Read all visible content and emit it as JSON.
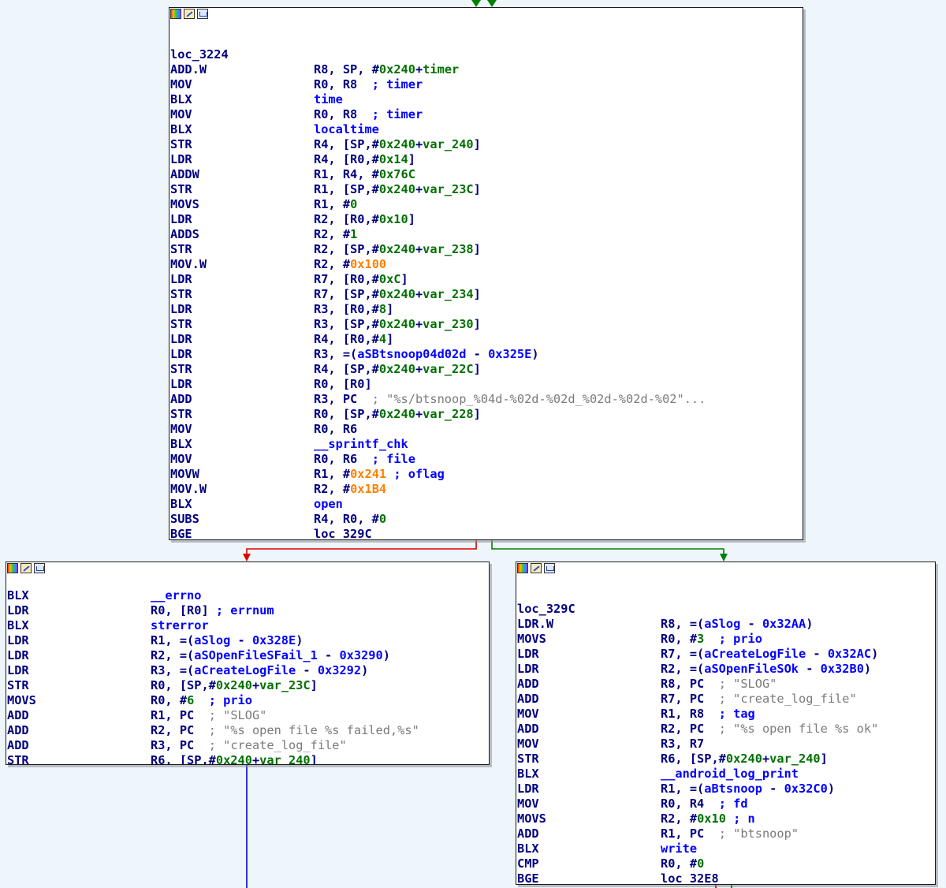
{
  "colors": {
    "background": "#eef6fb",
    "register": "#000080",
    "symbol": "#0000ff",
    "variable": "#007000",
    "immediate_hex": "#ff7f00",
    "string_comment": "#7a7a7a",
    "edge_true": "#008000",
    "edge_false": "#e00000",
    "edge_uncond": "#0000cc"
  },
  "titlebar_icons": [
    "color-palette-icon",
    "edit-pencil-icon",
    "graph-overview-icon"
  ],
  "blocks": [
    {
      "id": "top",
      "label": "loc_3224",
      "lines": [
        {
          "m": "ADD.W",
          "o": [
            [
              "reg",
              "R8, SP, "
            ],
            [
              "punct",
              "#"
            ],
            [
              "num",
              "0x240"
            ],
            [
              "punct",
              "+"
            ],
            [
              "var",
              "timer"
            ]
          ]
        },
        {
          "m": "MOV",
          "o": [
            [
              "reg",
              "R0, R8  "
            ],
            [
              "cmt",
              "; timer"
            ]
          ]
        },
        {
          "m": "BLX",
          "o": [
            [
              "sym",
              "time"
            ]
          ]
        },
        {
          "m": "MOV",
          "o": [
            [
              "reg",
              "R0, R8  "
            ],
            [
              "cmt",
              "; timer"
            ]
          ]
        },
        {
          "m": "BLX",
          "o": [
            [
              "sym",
              "localtime"
            ]
          ]
        },
        {
          "m": "STR",
          "o": [
            [
              "reg",
              "R4, [SP,#"
            ],
            [
              "num",
              "0x240"
            ],
            [
              "punct",
              "+"
            ],
            [
              "var",
              "var_240"
            ],
            [
              "punct",
              "]"
            ]
          ]
        },
        {
          "m": "LDR",
          "o": [
            [
              "reg",
              "R4, [R0,#"
            ],
            [
              "num",
              "0x14"
            ],
            [
              "punct",
              "]"
            ]
          ]
        },
        {
          "m": "ADDW",
          "o": [
            [
              "reg",
              "R1, R4, #"
            ],
            [
              "num",
              "0x76C"
            ]
          ]
        },
        {
          "m": "STR",
          "o": [
            [
              "reg",
              "R1, [SP,#"
            ],
            [
              "num",
              "0x240"
            ],
            [
              "punct",
              "+"
            ],
            [
              "var",
              "var_23C"
            ],
            [
              "punct",
              "]"
            ]
          ]
        },
        {
          "m": "MOVS",
          "o": [
            [
              "reg",
              "R1, #"
            ],
            [
              "num",
              "0"
            ]
          ]
        },
        {
          "m": "LDR",
          "o": [
            [
              "reg",
              "R2, [R0,#"
            ],
            [
              "num",
              "0x10"
            ],
            [
              "punct",
              "]"
            ]
          ]
        },
        {
          "m": "ADDS",
          "o": [
            [
              "reg",
              "R2, #"
            ],
            [
              "num",
              "1"
            ]
          ]
        },
        {
          "m": "STR",
          "o": [
            [
              "reg",
              "R2, [SP,#"
            ],
            [
              "num",
              "0x240"
            ],
            [
              "punct",
              "+"
            ],
            [
              "var",
              "var_238"
            ],
            [
              "punct",
              "]"
            ]
          ]
        },
        {
          "m": "MOV.W",
          "o": [
            [
              "reg",
              "R2, #"
            ],
            [
              "imm",
              "0x100"
            ]
          ]
        },
        {
          "m": "LDR",
          "o": [
            [
              "reg",
              "R7, [R0,#"
            ],
            [
              "num",
              "0xC"
            ],
            [
              "punct",
              "]"
            ]
          ]
        },
        {
          "m": "STR",
          "o": [
            [
              "reg",
              "R7, [SP,#"
            ],
            [
              "num",
              "0x240"
            ],
            [
              "punct",
              "+"
            ],
            [
              "var",
              "var_234"
            ],
            [
              "punct",
              "]"
            ]
          ]
        },
        {
          "m": "LDR",
          "o": [
            [
              "reg",
              "R3, [R0,#"
            ],
            [
              "num",
              "8"
            ],
            [
              "punct",
              "]"
            ]
          ]
        },
        {
          "m": "STR",
          "o": [
            [
              "reg",
              "R3, [SP,#"
            ],
            [
              "num",
              "0x240"
            ],
            [
              "punct",
              "+"
            ],
            [
              "var",
              "var_230"
            ],
            [
              "punct",
              "]"
            ]
          ]
        },
        {
          "m": "LDR",
          "o": [
            [
              "reg",
              "R4, [R0,#"
            ],
            [
              "num",
              "4"
            ],
            [
              "punct",
              "]"
            ]
          ]
        },
        {
          "m": "LDR",
          "o": [
            [
              "reg",
              "R3, =("
            ],
            [
              "sym",
              "aSBtsnoop04d02d"
            ],
            [
              "reg",
              " - "
            ],
            [
              "sym",
              "0x325E"
            ],
            [
              "reg",
              ")"
            ]
          ]
        },
        {
          "m": "STR",
          "o": [
            [
              "reg",
              "R4, [SP,#"
            ],
            [
              "num",
              "0x240"
            ],
            [
              "punct",
              "+"
            ],
            [
              "var",
              "var_22C"
            ],
            [
              "punct",
              "]"
            ]
          ]
        },
        {
          "m": "LDR",
          "o": [
            [
              "reg",
              "R0, [R0]"
            ]
          ]
        },
        {
          "m": "ADD",
          "o": [
            [
              "reg",
              "R3, PC  "
            ],
            [
              "str",
              "; \"%s/btsnoop_%04d-%02d-%02d_%02d-%02d-%02\"..."
            ]
          ]
        },
        {
          "m": "STR",
          "o": [
            [
              "reg",
              "R0, [SP,#"
            ],
            [
              "num",
              "0x240"
            ],
            [
              "punct",
              "+"
            ],
            [
              "var",
              "var_228"
            ],
            [
              "punct",
              "]"
            ]
          ]
        },
        {
          "m": "MOV",
          "o": [
            [
              "reg",
              "R0, R6"
            ]
          ]
        },
        {
          "m": "BLX",
          "o": [
            [
              "sym",
              "__sprintf_chk"
            ]
          ]
        },
        {
          "m": "MOV",
          "o": [
            [
              "reg",
              "R0, R6  "
            ],
            [
              "cmt",
              "; file"
            ]
          ]
        },
        {
          "m": "MOVW",
          "o": [
            [
              "reg",
              "R1, #"
            ],
            [
              "imm",
              "0x241"
            ],
            [
              "cmt",
              " ; oflag"
            ]
          ]
        },
        {
          "m": "MOV.W",
          "o": [
            [
              "reg",
              "R2, #"
            ],
            [
              "imm",
              "0x1B4"
            ]
          ]
        },
        {
          "m": "BLX",
          "o": [
            [
              "sym",
              "open"
            ]
          ]
        },
        {
          "m": "SUBS",
          "o": [
            [
              "reg",
              "R4, R0, #"
            ],
            [
              "num",
              "0"
            ]
          ]
        },
        {
          "m": "BGE",
          "o": [
            [
              "reg",
              "loc_329C"
            ]
          ]
        }
      ]
    },
    {
      "id": "left",
      "label": "",
      "lines": [
        {
          "m": "BLX",
          "o": [
            [
              "sym",
              "__errno"
            ]
          ]
        },
        {
          "m": "LDR",
          "o": [
            [
              "reg",
              "R0, [R0] "
            ],
            [
              "cmt",
              "; errnum"
            ]
          ]
        },
        {
          "m": "BLX",
          "o": [
            [
              "sym",
              "strerror"
            ]
          ]
        },
        {
          "m": "LDR",
          "o": [
            [
              "reg",
              "R1, =("
            ],
            [
              "sym",
              "aSlog"
            ],
            [
              "reg",
              " - "
            ],
            [
              "sym",
              "0x328E"
            ],
            [
              "reg",
              ")"
            ]
          ]
        },
        {
          "m": "LDR",
          "o": [
            [
              "reg",
              "R2, =("
            ],
            [
              "sym",
              "aSOpenFileSFail_1"
            ],
            [
              "reg",
              " - "
            ],
            [
              "sym",
              "0x3290"
            ],
            [
              "reg",
              ")"
            ]
          ]
        },
        {
          "m": "LDR",
          "o": [
            [
              "reg",
              "R3, =("
            ],
            [
              "sym",
              "aCreateLogFile"
            ],
            [
              "reg",
              " - "
            ],
            [
              "sym",
              "0x3292"
            ],
            [
              "reg",
              ")"
            ]
          ]
        },
        {
          "m": "STR",
          "o": [
            [
              "reg",
              "R0, [SP,#"
            ],
            [
              "num",
              "0x240"
            ],
            [
              "punct",
              "+"
            ],
            [
              "var",
              "var_23C"
            ],
            [
              "punct",
              "]"
            ]
          ]
        },
        {
          "m": "MOVS",
          "o": [
            [
              "reg",
              "R0, #"
            ],
            [
              "num",
              "6"
            ],
            [
              "cmt",
              "  ; prio"
            ]
          ]
        },
        {
          "m": "ADD",
          "o": [
            [
              "reg",
              "R1, PC  "
            ],
            [
              "str",
              "; \"SLOG\""
            ]
          ]
        },
        {
          "m": "ADD",
          "o": [
            [
              "reg",
              "R2, PC  "
            ],
            [
              "str",
              "; \"%s open file %s failed,%s\""
            ]
          ]
        },
        {
          "m": "ADD",
          "o": [
            [
              "reg",
              "R3, PC  "
            ],
            [
              "str",
              "; \"create_log_file\""
            ]
          ]
        },
        {
          "m": "STR",
          "o": [
            [
              "reg",
              "R6, [SP,#"
            ],
            [
              "num",
              "0x240"
            ],
            [
              "punct",
              "+"
            ],
            [
              "var",
              "var_240"
            ],
            [
              "punct",
              "]"
            ]
          ]
        }
      ]
    },
    {
      "id": "right",
      "label": "loc_329C",
      "lines": [
        {
          "m": "LDR.W",
          "o": [
            [
              "reg",
              "R8, =("
            ],
            [
              "sym",
              "aSlog"
            ],
            [
              "reg",
              " - "
            ],
            [
              "sym",
              "0x32AA"
            ],
            [
              "reg",
              ")"
            ]
          ]
        },
        {
          "m": "MOVS",
          "o": [
            [
              "reg",
              "R0, #"
            ],
            [
              "num",
              "3"
            ],
            [
              "cmt",
              "  ; prio"
            ]
          ]
        },
        {
          "m": "LDR",
          "o": [
            [
              "reg",
              "R7, =("
            ],
            [
              "sym",
              "aCreateLogFile"
            ],
            [
              "reg",
              " - "
            ],
            [
              "sym",
              "0x32AC"
            ],
            [
              "reg",
              ")"
            ]
          ]
        },
        {
          "m": "LDR",
          "o": [
            [
              "reg",
              "R2, =("
            ],
            [
              "sym",
              "aSOpenFileSOk"
            ],
            [
              "reg",
              " - "
            ],
            [
              "sym",
              "0x32B0"
            ],
            [
              "reg",
              ")"
            ]
          ]
        },
        {
          "m": "ADD",
          "o": [
            [
              "reg",
              "R8, PC  "
            ],
            [
              "str",
              "; \"SLOG\""
            ]
          ]
        },
        {
          "m": "ADD",
          "o": [
            [
              "reg",
              "R7, PC  "
            ],
            [
              "str",
              "; \"create_log_file\""
            ]
          ]
        },
        {
          "m": "MOV",
          "o": [
            [
              "reg",
              "R1, R8  "
            ],
            [
              "cmt",
              "; tag"
            ]
          ]
        },
        {
          "m": "ADD",
          "o": [
            [
              "reg",
              "R2, PC  "
            ],
            [
              "str",
              "; \"%s open file %s ok\""
            ]
          ]
        },
        {
          "m": "MOV",
          "o": [
            [
              "reg",
              "R3, R7"
            ]
          ]
        },
        {
          "m": "STR",
          "o": [
            [
              "reg",
              "R6, [SP,#"
            ],
            [
              "num",
              "0x240"
            ],
            [
              "punct",
              "+"
            ],
            [
              "var",
              "var_240"
            ],
            [
              "punct",
              "]"
            ]
          ]
        },
        {
          "m": "BLX",
          "o": [
            [
              "sym",
              "__android_log_print"
            ]
          ]
        },
        {
          "m": "LDR",
          "o": [
            [
              "reg",
              "R1, =("
            ],
            [
              "sym",
              "aBtsnoop"
            ],
            [
              "reg",
              " - "
            ],
            [
              "sym",
              "0x32C0"
            ],
            [
              "reg",
              ")"
            ]
          ]
        },
        {
          "m": "MOV",
          "o": [
            [
              "reg",
              "R0, R4  "
            ],
            [
              "cmt",
              "; fd"
            ]
          ]
        },
        {
          "m": "MOVS",
          "o": [
            [
              "reg",
              "R2, #"
            ],
            [
              "num",
              "0x10"
            ],
            [
              "cmt",
              " ; n"
            ]
          ]
        },
        {
          "m": "ADD",
          "o": [
            [
              "reg",
              "R1, PC  "
            ],
            [
              "str",
              "; \"btsnoop\""
            ]
          ]
        },
        {
          "m": "BLX",
          "o": [
            [
              "sym",
              "write"
            ]
          ]
        },
        {
          "m": "CMP",
          "o": [
            [
              "reg",
              "R0, #"
            ],
            [
              "num",
              "0"
            ]
          ]
        },
        {
          "m": "BGE",
          "o": [
            [
              "reg",
              "loc_32E8"
            ]
          ]
        }
      ]
    }
  ]
}
